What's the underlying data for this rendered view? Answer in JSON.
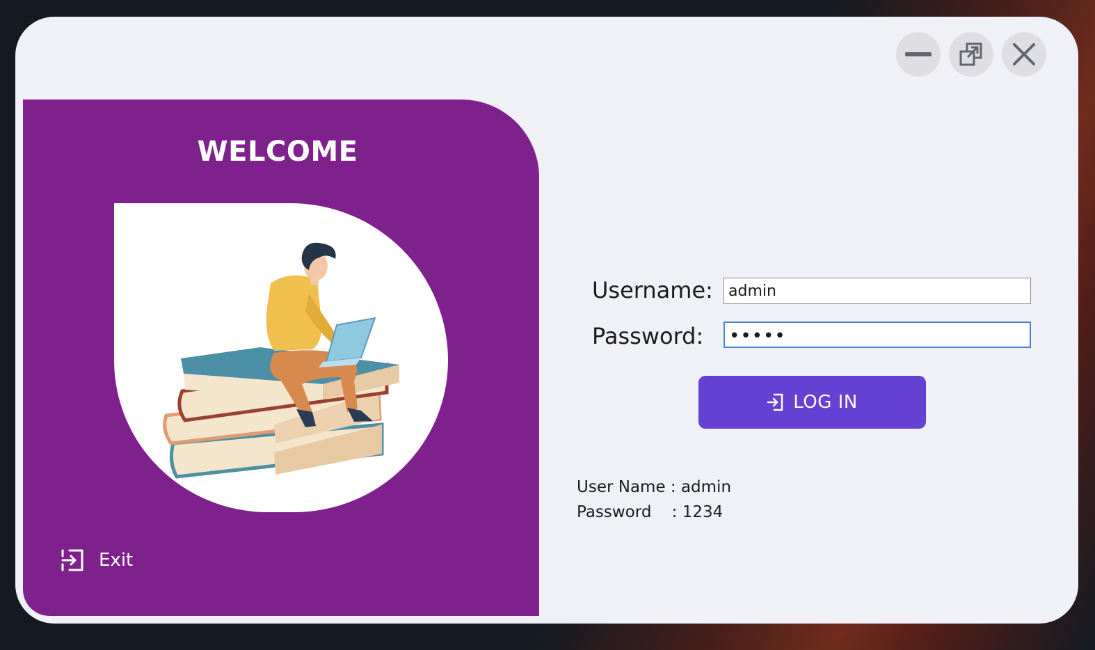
{
  "window": {
    "controls": {
      "minimize_icon": "minimize-icon",
      "maximize_icon": "restore-icon",
      "close_icon": "close-icon"
    }
  },
  "left_panel": {
    "title": "WELCOME",
    "illustration": "person-reading-on-books",
    "exit_label": "Exit",
    "exit_icon": "exit-icon",
    "color": "#7e218c"
  },
  "form": {
    "username_label": "Username:",
    "password_label": "Password:",
    "username_value": "admin",
    "password_value": "•••••",
    "login_label": "LOG IN",
    "login_icon": "login-icon",
    "login_color": "#6541d3"
  },
  "hint": {
    "user_line": "User Name : admin",
    "pass_line": "Password    : 1234"
  }
}
